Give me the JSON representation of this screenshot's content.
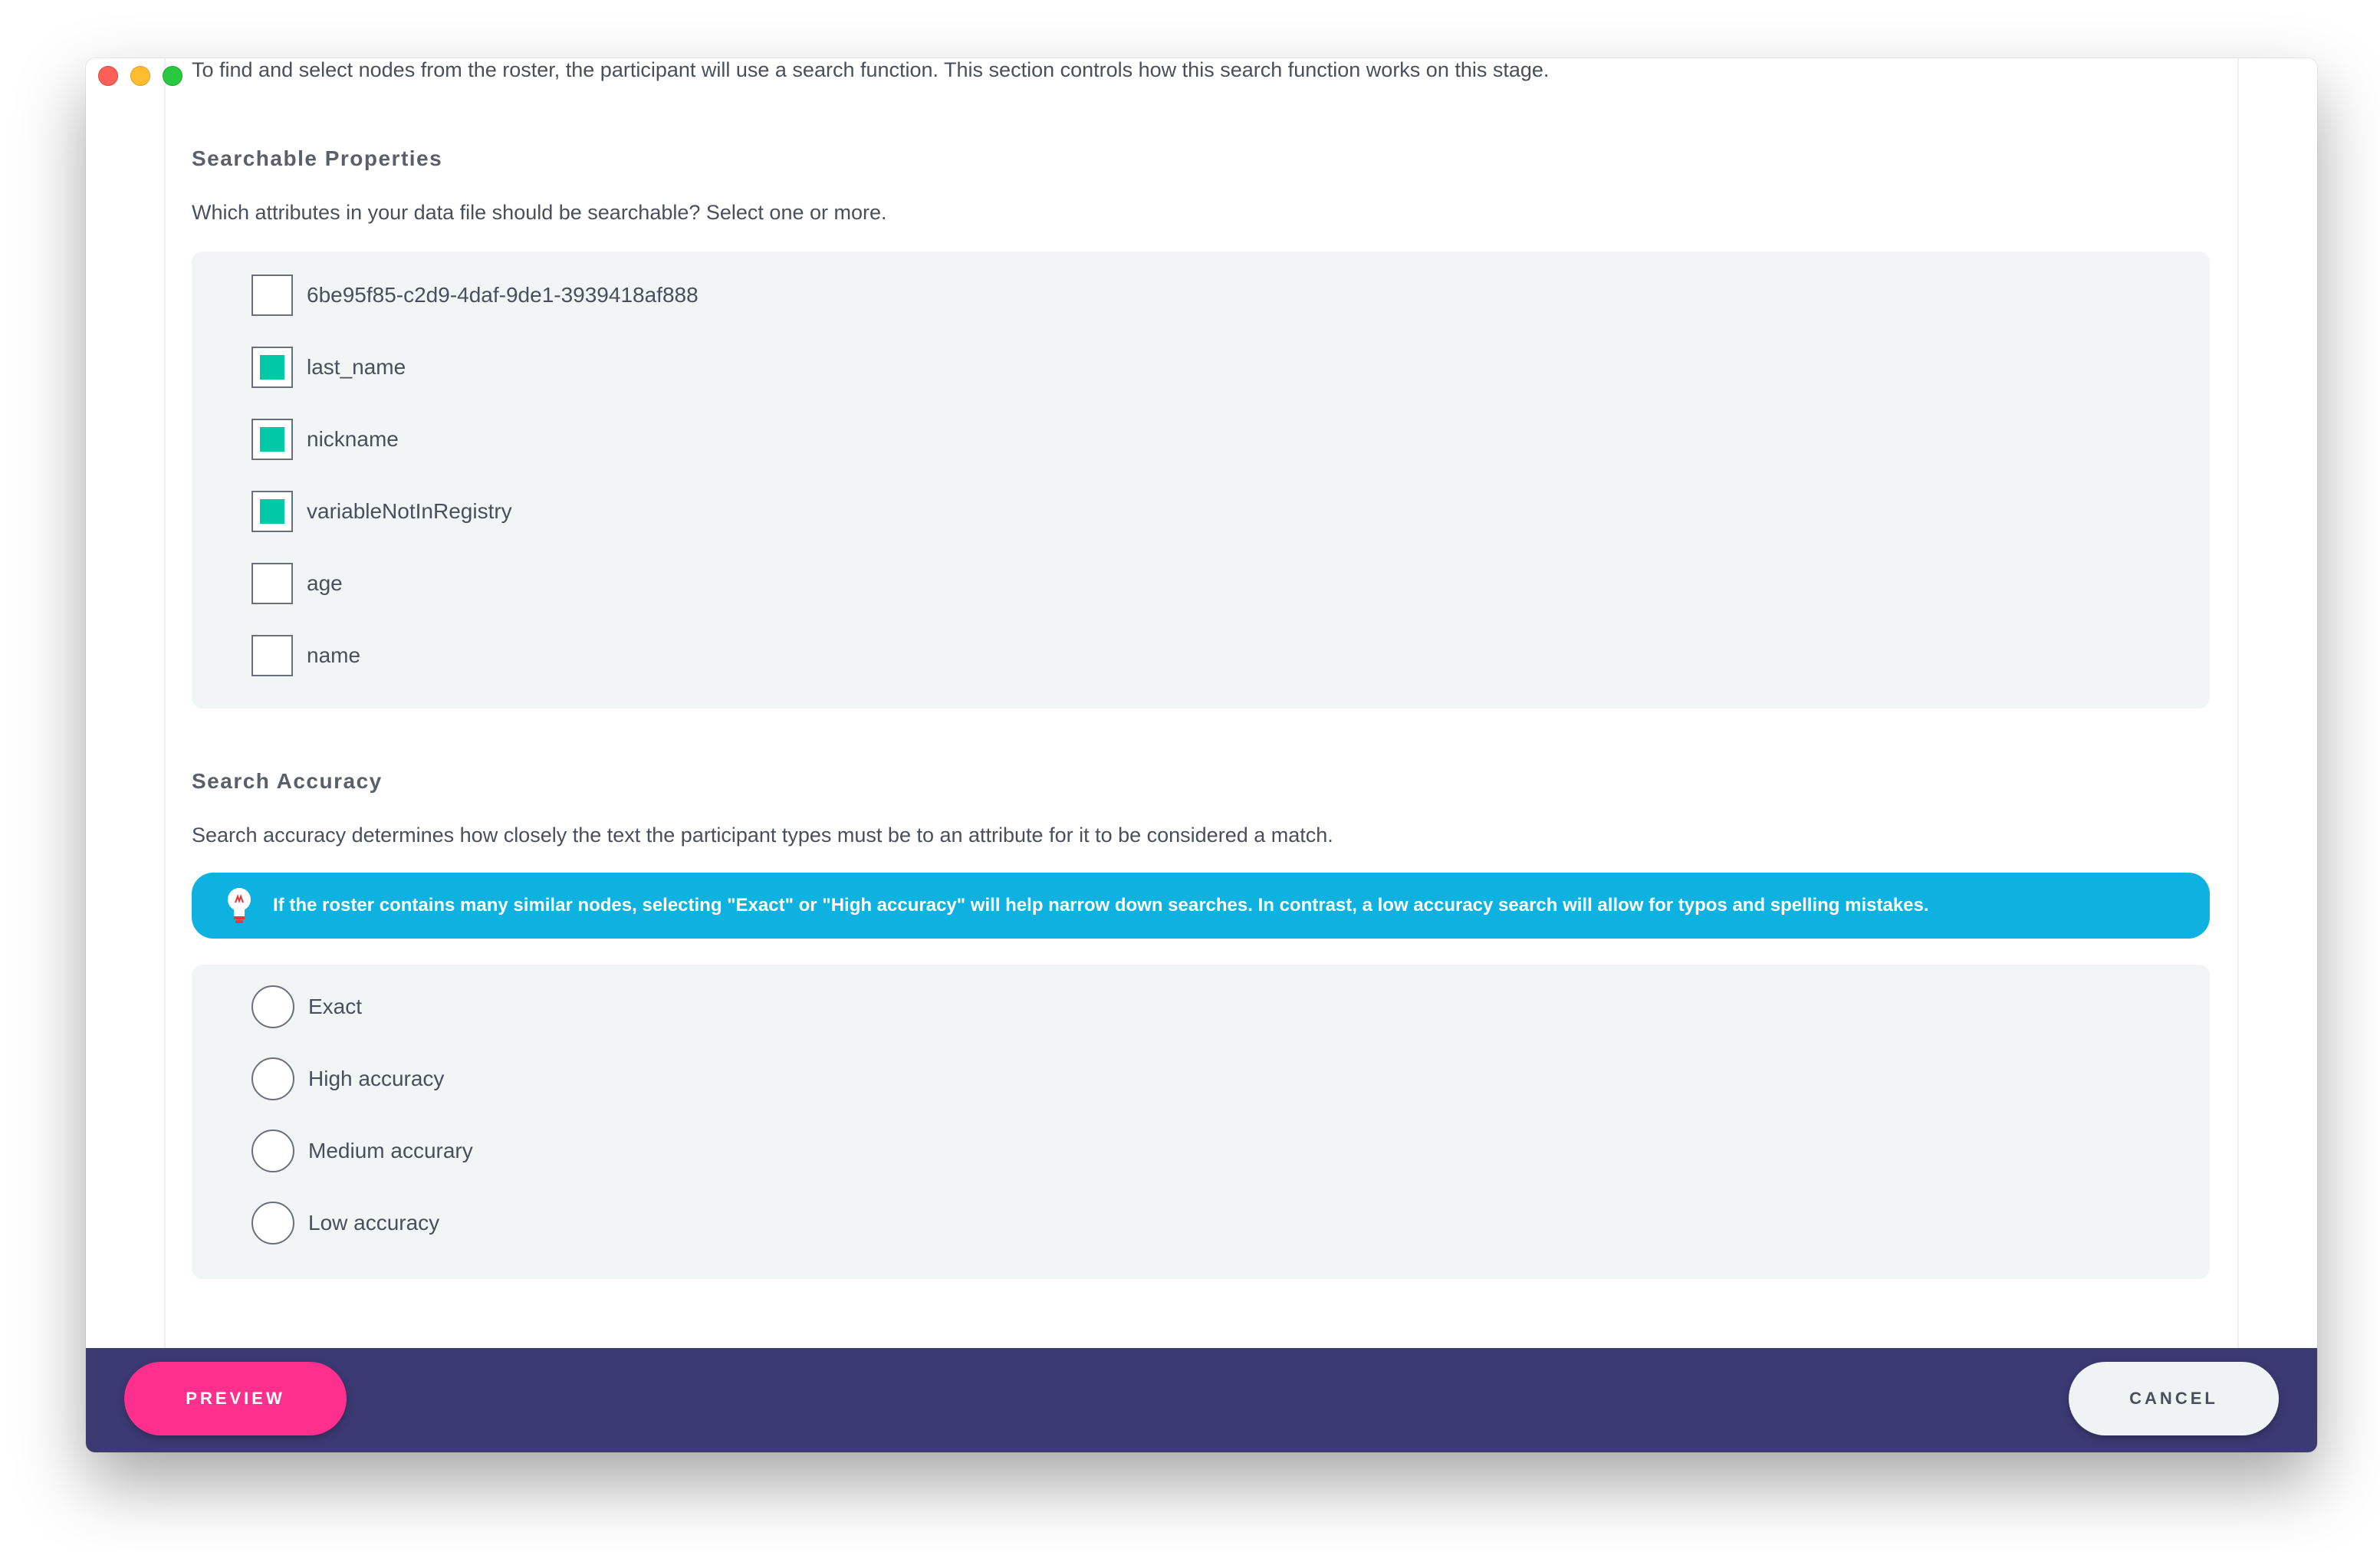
{
  "intro_text": "To find and select nodes from the roster, the participant will use a search function. This section controls how this search function works on this stage.",
  "searchable": {
    "title": "Searchable Properties",
    "description": "Which attributes in your data file should be searchable? Select one or more.",
    "options": [
      {
        "label": "6be95f85-c2d9-4daf-9de1-3939418af888",
        "checked": false
      },
      {
        "label": "last_name",
        "checked": true
      },
      {
        "label": "nickname",
        "checked": true
      },
      {
        "label": "variableNotInRegistry",
        "checked": true
      },
      {
        "label": "age",
        "checked": false
      },
      {
        "label": "name",
        "checked": false
      }
    ]
  },
  "accuracy": {
    "title": "Search Accuracy",
    "description": "Search accuracy determines how closely the text the participant types must be to an attribute for it to be considered a match.",
    "tip": "If the roster contains many similar nodes, selecting \"Exact\" or \"High accuracy\" will help narrow down searches. In contrast, a low accuracy search will allow for typos and spelling mistakes.",
    "options": [
      {
        "label": "Exact",
        "selected": false
      },
      {
        "label": "High accuracy",
        "selected": false
      },
      {
        "label": "Medium accurary",
        "selected": false
      },
      {
        "label": "Low accuracy",
        "selected": false
      }
    ]
  },
  "footer": {
    "preview_label": "PREVIEW",
    "cancel_label": "CANCEL"
  },
  "colors": {
    "accent_checked": "#00c9a7",
    "banner": "#0eb2e0",
    "footer": "#3c3a73",
    "preview_button": "#ff2f8e"
  }
}
